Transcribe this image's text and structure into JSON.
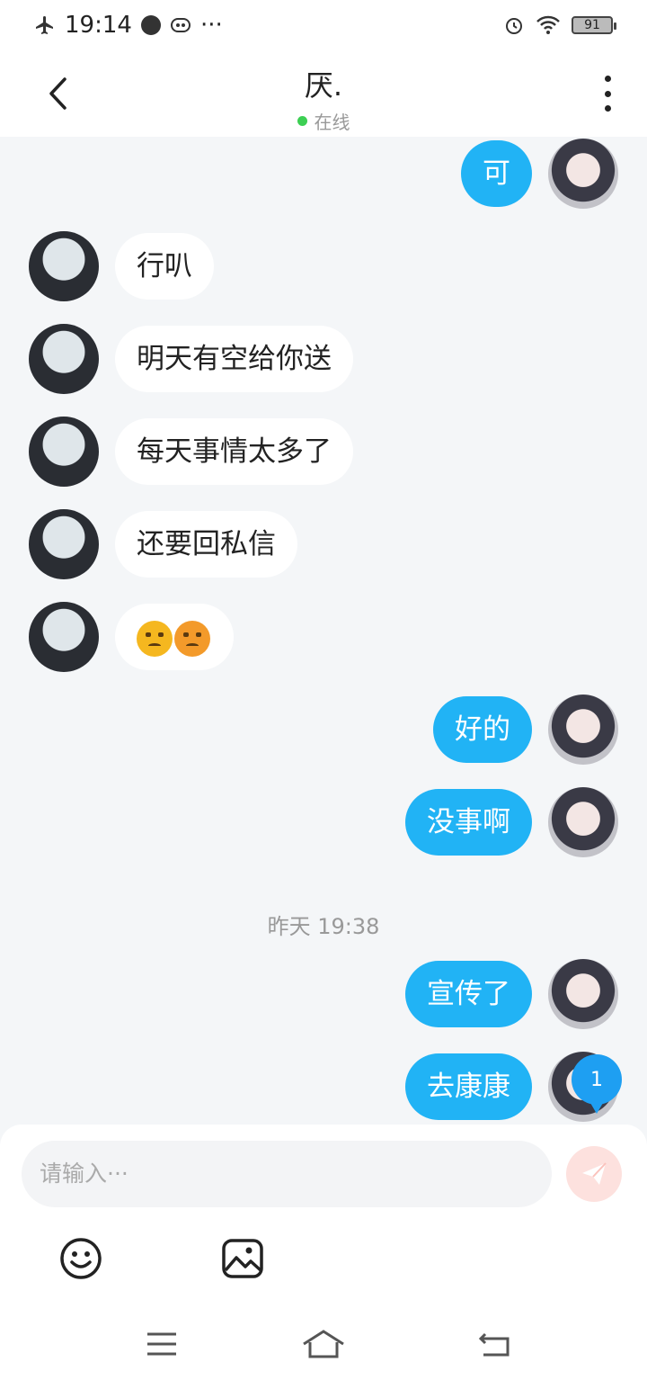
{
  "status_bar": {
    "time": "19:14",
    "battery": "91"
  },
  "header": {
    "title": "厌.",
    "status": "在线"
  },
  "messages": [
    {
      "side": "out",
      "text": "可"
    },
    {
      "side": "in",
      "text": "行叭"
    },
    {
      "side": "in",
      "text": "明天有空给你送"
    },
    {
      "side": "in",
      "text": "每天事情太多了"
    },
    {
      "side": "in",
      "text": "还要回私信"
    },
    {
      "side": "in",
      "text": "",
      "emojis": [
        "persevering-face",
        "worried-face"
      ]
    },
    {
      "side": "out",
      "text": "好的"
    },
    {
      "side": "out",
      "text": "没事啊"
    },
    {
      "side": "out",
      "text": "宣传了"
    },
    {
      "side": "out",
      "text": "去康康"
    }
  ],
  "timestamp": "昨天 19:38",
  "unread_badge": "1",
  "input": {
    "placeholder": "请输入···"
  },
  "toolbar": {
    "emoji_icon": "smiley-icon",
    "image_icon": "image-icon"
  },
  "colors": {
    "outgoing_bubble": "#21b3f5",
    "incoming_bubble": "#ffffff",
    "background": "#f4f6f8",
    "online_dot": "#3ccf53",
    "send_button": "#fde1de"
  }
}
